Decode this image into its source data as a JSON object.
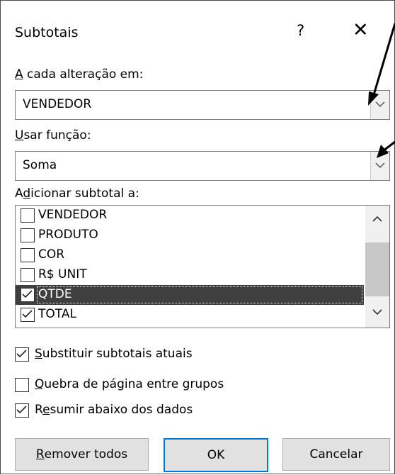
{
  "dialog": {
    "title": "Subtotais",
    "help": "?",
    "close": "✕"
  },
  "at_each_change": {
    "label_accel": "A",
    "label_rest": " cada alteração em:",
    "value": "VENDEDOR"
  },
  "use_function": {
    "label_accel": "U",
    "label_rest": "sar função:",
    "value": "Soma"
  },
  "add_subtotal": {
    "label_pre": "A",
    "label_accel": "d",
    "label_rest": "icionar subtotal a:",
    "items": [
      {
        "label": "VENDEDOR",
        "checked": false,
        "selected": false
      },
      {
        "label": "PRODUTO",
        "checked": false,
        "selected": false
      },
      {
        "label": "COR",
        "checked": false,
        "selected": false
      },
      {
        "label": "R$ UNIT",
        "checked": false,
        "selected": false
      },
      {
        "label": "QTDE",
        "checked": true,
        "selected": true
      },
      {
        "label": "TOTAL",
        "checked": true,
        "selected": false
      }
    ]
  },
  "options": [
    {
      "accel": "S",
      "rest": "ubstituir subtotais atuais",
      "checked": true
    },
    {
      "accel": "Q",
      "rest": "uebra de página entre grupos",
      "checked": false
    },
    {
      "pre": "R",
      "accel": "e",
      "rest": "sumir abaixo dos dados",
      "checked": true
    }
  ],
  "buttons": {
    "remove_accel": "R",
    "remove_rest": "emover todos",
    "ok": "OK",
    "cancel": "Cancelar"
  },
  "colors": {
    "selection": "#3f3f3f",
    "default_button_border": "#0078d7",
    "button_face": "#e1e1e1"
  }
}
